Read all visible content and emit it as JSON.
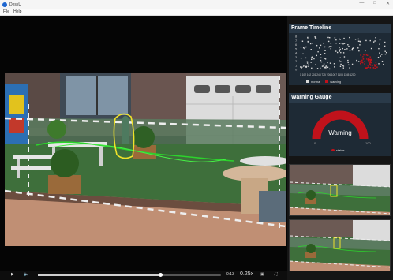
{
  "window": {
    "title": "DeskU",
    "menu": [
      "File",
      "Help"
    ]
  },
  "player": {
    "time": "0:13",
    "speed": "0.25x",
    "progress": 0.67
  },
  "frame_timeline": {
    "title": "Frame Timeline",
    "y_ticks": [
      "8",
      "7",
      "6",
      "5",
      "4",
      "3",
      "2",
      "1",
      "0"
    ],
    "x_ticks": "1 102 162 201 243 725 706 1007 1108 1145 1200",
    "legend": {
      "normal": "normal",
      "warning": "warning"
    },
    "colors": {
      "normal": "#d9d9d9",
      "warning": "#c0121b"
    }
  },
  "warning_gauge": {
    "title": "Warning Gauge",
    "label": "Warning",
    "min_label": "0",
    "max_label": "100",
    "legend": "status",
    "value_fraction": 1.0,
    "color": "#c0121b"
  },
  "icons": [
    "play-icon",
    "volume-icon",
    "snapshot-icon",
    "fullscreen-icon",
    "minimize-icon",
    "maximize-icon",
    "close-icon"
  ]
}
